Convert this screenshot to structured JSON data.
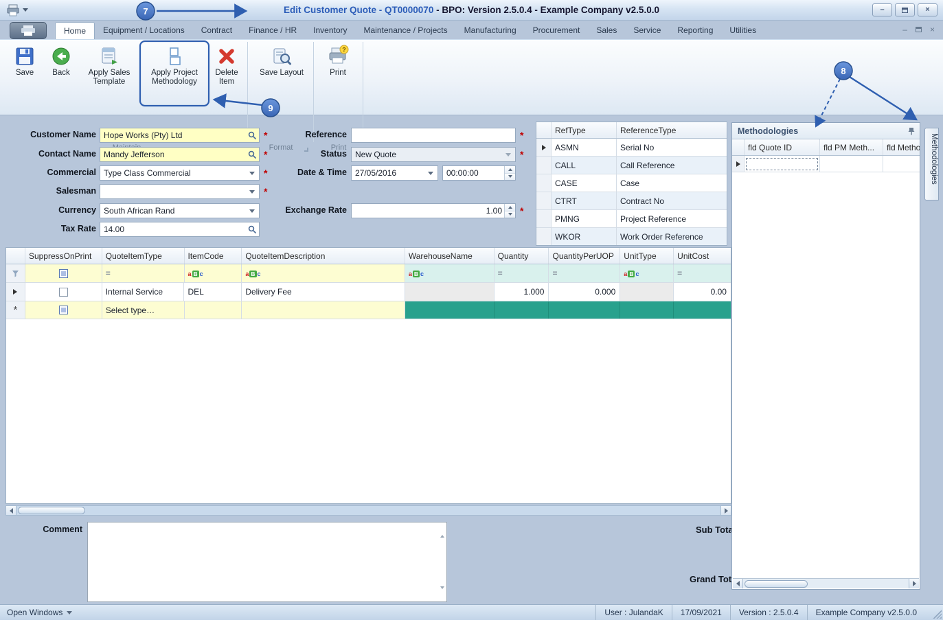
{
  "window": {
    "title_primary": "Edit Customer Quote - QT0000070 ",
    "title_secondary": "- BPO: Version 2.5.0.4 - Example Company v2.5.0.0",
    "controls": {
      "minimize": "–",
      "close": "×"
    }
  },
  "ribbon": {
    "tabs": [
      "Home",
      "Equipment / Locations",
      "Contract",
      "Finance / HR",
      "Inventory",
      "Maintenance / Projects",
      "Manufacturing",
      "Procurement",
      "Sales",
      "Service",
      "Reporting",
      "Utilities"
    ],
    "buttons": {
      "save": "Save",
      "back": "Back",
      "apply_sales_template": "Apply Sales Template",
      "apply_project_methodology": "Apply Project Methodology",
      "delete_item": "Delete Item",
      "save_layout": "Save Layout",
      "print": "Print"
    },
    "groups": {
      "maintain": "Maintain",
      "format": "Format",
      "print": "Print"
    }
  },
  "form": {
    "customer_name": {
      "label": "Customer Name",
      "value": "Hope Works (Pty) Ltd"
    },
    "contact_name": {
      "label": "Contact Name",
      "value": "Mandy Jefferson"
    },
    "commercial": {
      "label": "Commercial",
      "value": "Type Class Commercial"
    },
    "salesman": {
      "label": "Salesman",
      "value": ""
    },
    "currency": {
      "label": "Currency",
      "value": "South African Rand"
    },
    "tax_rate": {
      "label": "Tax Rate",
      "value": "14.00"
    },
    "reference": {
      "label": "Reference",
      "value": ""
    },
    "status": {
      "label": "Status",
      "value": "New Quote"
    },
    "date_time": {
      "label": "Date & Time",
      "date": "27/05/2016",
      "time": "00:00:00"
    },
    "exchange_rate": {
      "label": "Exchange Rate",
      "value": "1.00"
    },
    "required_marker": "*"
  },
  "reftype_grid": {
    "columns": [
      "RefType",
      "ReferenceType"
    ],
    "rows": [
      [
        "ASMN",
        "Serial No"
      ],
      [
        "CALL",
        "Call Reference"
      ],
      [
        "CASE",
        "Case"
      ],
      [
        "CTRT",
        "Contract No"
      ],
      [
        "PMNG",
        "Project Reference"
      ],
      [
        "WKOR",
        "Work Order Reference"
      ]
    ]
  },
  "methodologies": {
    "title": "Methodologies",
    "columns": [
      "fld Quote ID",
      "fld PM Meth...",
      "fld Methodol"
    ],
    "side_tab": "Methodologies"
  },
  "items_grid": {
    "columns": [
      "SuppressOnPrint",
      "QuoteItemType",
      "ItemCode",
      "QuoteItemDescription",
      "WarehouseName",
      "Quantity",
      "QuantityPerUOP",
      "UnitType",
      "UnitCost"
    ],
    "filter": {
      "equals": "=",
      "abc": [
        "a",
        "B",
        "c"
      ]
    },
    "new_row_indicator": "*",
    "row1": {
      "quote_item_type": "Internal Service",
      "item_code": "DEL",
      "description": "Delivery Fee",
      "quantity": "1.000",
      "quantity_per_uop": "0.000",
      "unit_cost": "0.00"
    },
    "new_row": {
      "quote_item_type": "Select type…"
    }
  },
  "footer": {
    "comment_label": "Comment",
    "sub_total_label": "Sub Total",
    "grand_total_label": "Grand Total"
  },
  "statusbar": {
    "open_windows": "Open Windows",
    "user": "User : JulandaK",
    "date": "17/09/2021",
    "version": "Version : 2.5.0.4",
    "company": "Example Company v2.5.0.0"
  },
  "annotations": {
    "n7": "7",
    "n8": "8",
    "n9": "9"
  }
}
